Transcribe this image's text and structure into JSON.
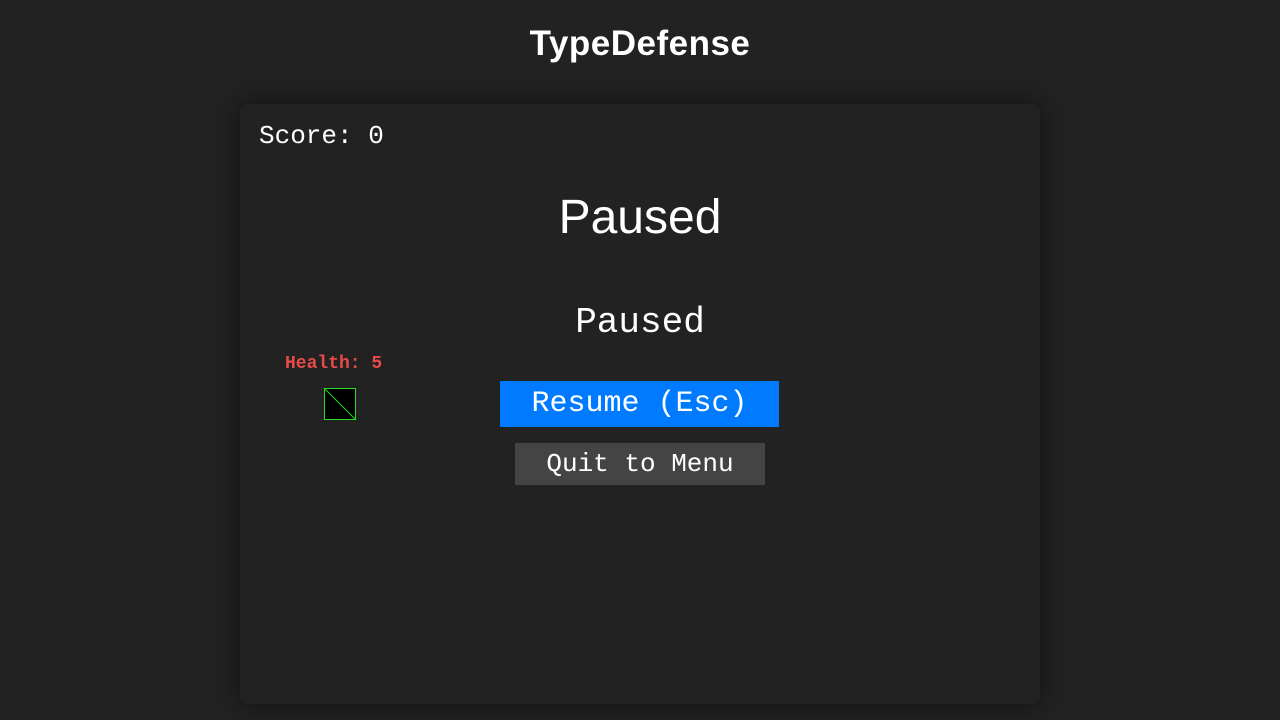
{
  "app": {
    "title": "TypeDefense"
  },
  "hud": {
    "score_text": "Score: 0",
    "health_text": "Health: 5"
  },
  "pause_menu": {
    "heading": "Paused",
    "subheading": "Paused",
    "resume_label": "Resume (Esc)",
    "quit_label": "Quit to Menu"
  },
  "player": {
    "icon": "player-square-icon"
  },
  "colors": {
    "background": "#222222",
    "text": "#ffffff",
    "health": "#e84a4a",
    "player_outline": "#22dd22",
    "resume_button": "#007bff",
    "quit_button": "#444444"
  }
}
